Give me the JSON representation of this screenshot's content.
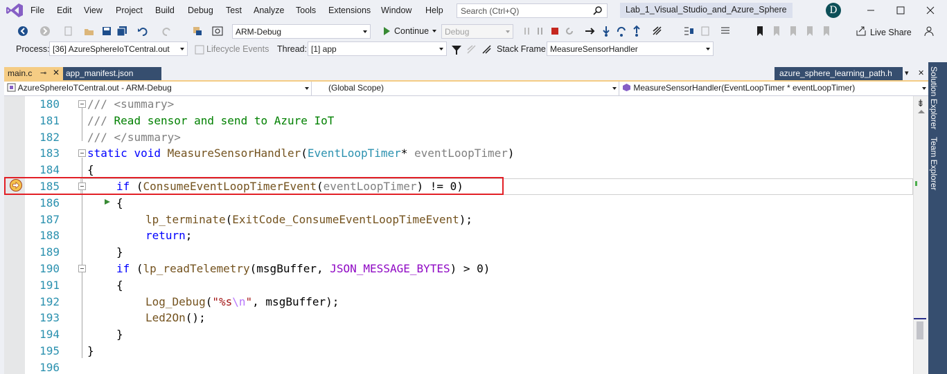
{
  "menu": {
    "items": [
      "File",
      "Edit",
      "View",
      "Project",
      "Build",
      "Debug",
      "Test",
      "Analyze",
      "Tools",
      "Extensions",
      "Window",
      "Help"
    ],
    "search_placeholder": "Search (Ctrl+Q)",
    "solution_title": "Lab_1_Visual_Studio_and_Azure_Sphere",
    "avatar_initial": "D"
  },
  "toolbar1": {
    "config": "ARM-Debug",
    "continue_label": "Continue",
    "debug_combo": "Debug",
    "live_share_label": "Live Share"
  },
  "toolbar2": {
    "process_label": "Process:",
    "process_value": "[36] AzureSphereIoTCentral.out",
    "lifecycle_label": "Lifecycle Events",
    "thread_label": "Thread:",
    "thread_value": "[1] app",
    "stack_frame_label": "Stack Frame:",
    "stack_frame_value": "MeasureSensorHandler"
  },
  "tabs": {
    "active": "main.c",
    "second": "app_manifest.json",
    "right": "azure_sphere_learning_path.h"
  },
  "navbar": {
    "project": "AzureSphereIoTCentral.out - ARM-Debug",
    "scope": "(Global Scope)",
    "member": "MeasureSensorHandler(EventLoopTimer * eventLoopTimer)"
  },
  "editor": {
    "line_numbers": [
      "180",
      "181",
      "182",
      "183",
      "184",
      "185",
      "186",
      "187",
      "188",
      "189",
      "190",
      "191",
      "192",
      "193",
      "194",
      "195",
      "196"
    ],
    "current_line": "185"
  },
  "side_panel": {
    "solution_explorer": "Solution Explorer",
    "team_explorer": "Team Explorer"
  },
  "colors": {
    "accent_tab": "#f5cc84",
    "breakpoint_box": "#e21f26",
    "side_panel": "#364e6f"
  }
}
